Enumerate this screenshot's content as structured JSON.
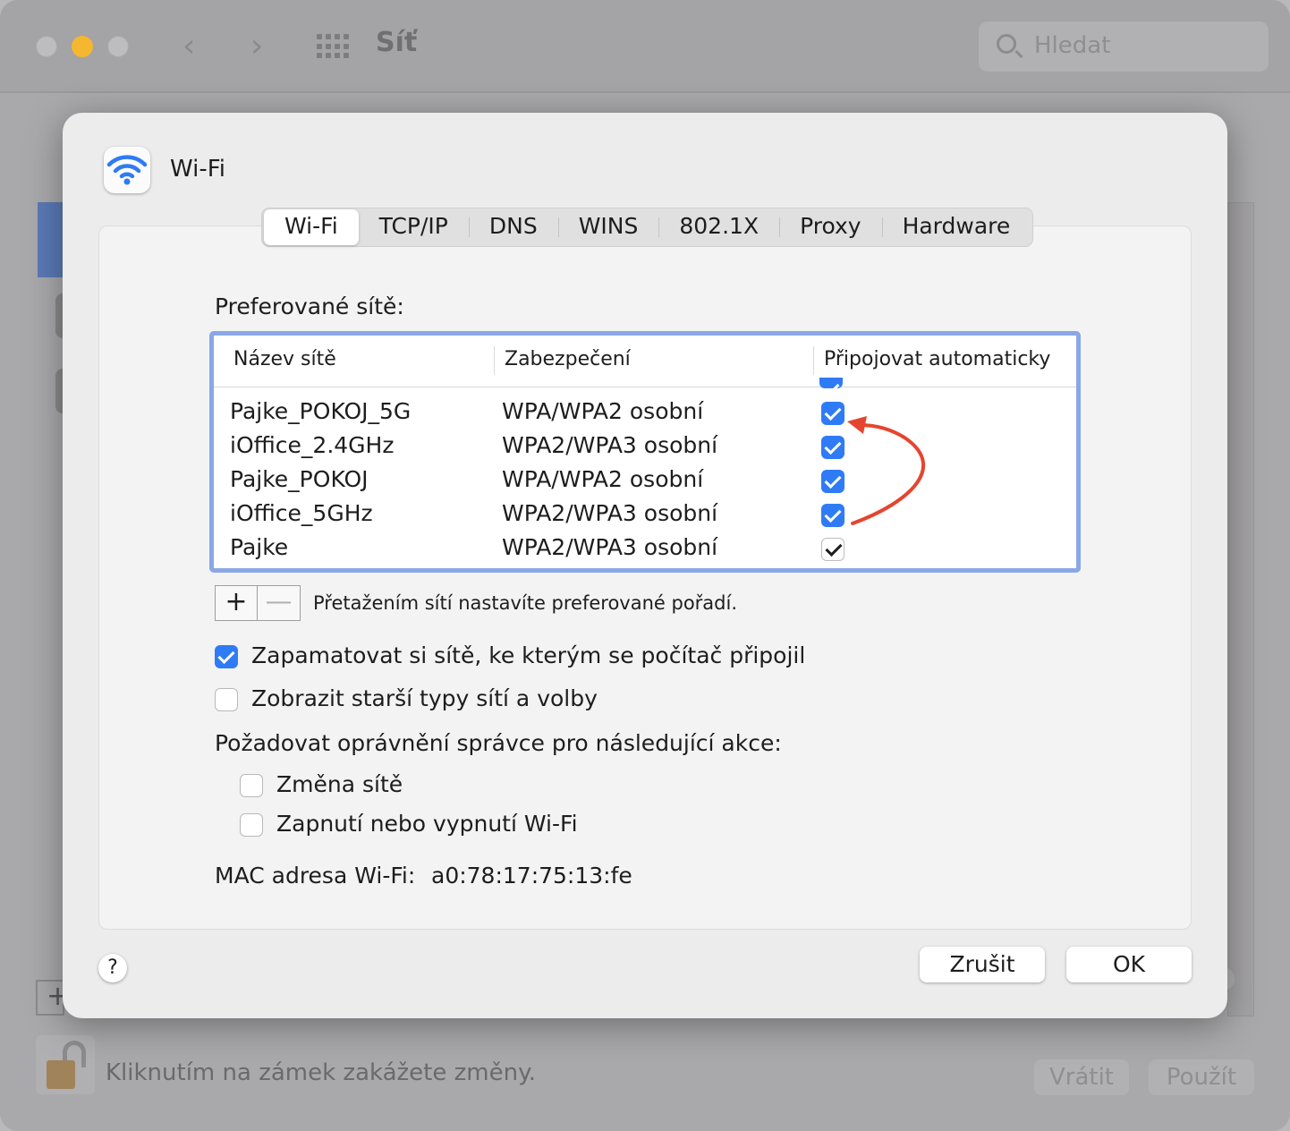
{
  "background_window": {
    "title": "Síť",
    "search_placeholder": "Hledat",
    "lock_text": "Kliknutím na zámek zakážete změny.",
    "revert_label": "Vrátit",
    "apply_label": "Použít",
    "add_label": "+"
  },
  "sheet": {
    "title": "Wi-Fi",
    "tabs": [
      "Wi-Fi",
      "TCP/IP",
      "DNS",
      "WINS",
      "802.1X",
      "Proxy",
      "Hardware"
    ],
    "active_tab": "Wi-Fi",
    "preferred_label": "Preferované sítě:",
    "columns": [
      "Název sítě",
      "Zabezpečení",
      "Připojovat automaticky"
    ],
    "networks": [
      {
        "name": "Pajke_POKOJ_5G",
        "security": "WPA/WPA2 osobní",
        "auto_join": true
      },
      {
        "name": "iOffice_2.4GHz",
        "security": "WPA2/WPA3 osobní",
        "auto_join": true
      },
      {
        "name": "Pajke_POKOJ",
        "security": "WPA/WPA2 osobní",
        "auto_join": true
      },
      {
        "name": "iOffice_5GHz",
        "security": "WPA2/WPA3 osobní",
        "auto_join": true
      },
      {
        "name": "Pajke",
        "security": "WPA2/WPA3 osobní",
        "auto_join": true
      }
    ],
    "add_label": "+",
    "remove_label": "—",
    "drag_hint": "Přetažením sítí nastavíte preferované pořadí.",
    "remember_label": "Zapamatovat si sítě, ke kterým se počítač připojil",
    "remember_checked": true,
    "legacy_label": "Zobrazit starší typy sítí a volby",
    "legacy_checked": false,
    "admin_section": "Požadovat oprávnění správce pro následující akce:",
    "change_network_label": "Změna sítě",
    "change_network_checked": false,
    "toggle_wifi_label": "Zapnutí nebo vypnutí Wi-Fi",
    "toggle_wifi_checked": false,
    "mac_label": "MAC adresa Wi-Fi:",
    "mac_value": "a0:78:17:75:13:fe",
    "help_label": "?",
    "cancel_label": "Zrušit",
    "ok_label": "OK"
  },
  "colors": {
    "accent": "#2f7bf5",
    "annotation_arrow": "#e5452f",
    "table_focus_ring": "#8aa7e6"
  }
}
